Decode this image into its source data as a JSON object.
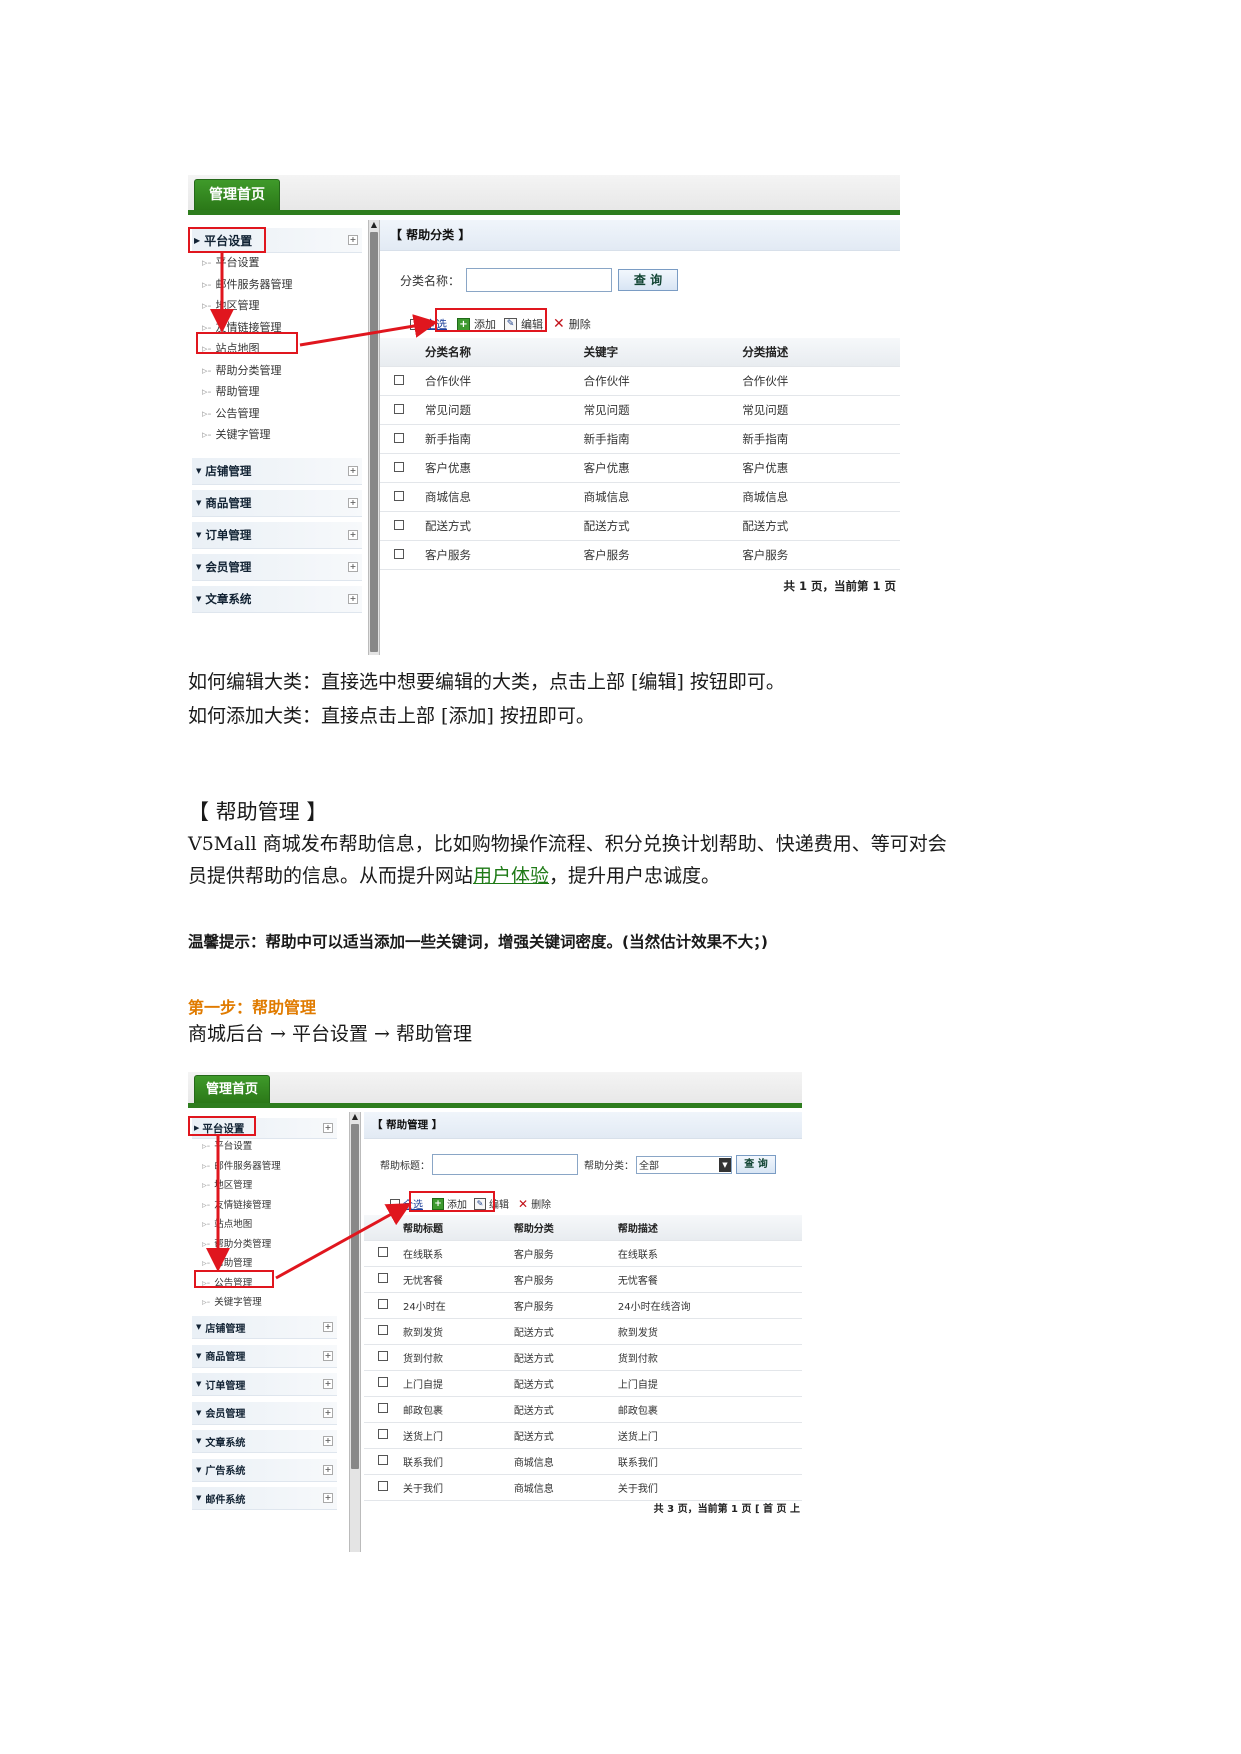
{
  "shot1": {
    "home_tab": "管理首页",
    "platform_menu": "平台设置",
    "sub_items": [
      "平台设置",
      "邮件服务器管理",
      "地区管理",
      "友情链接管理",
      "站点地图",
      "帮助分类管理",
      "帮助管理",
      "公告管理",
      "关键字管理"
    ],
    "other_menus": [
      "店铺管理",
      "商品管理",
      "订单管理",
      "会员管理",
      "文章系统"
    ],
    "section_title": "【  帮助分类  】",
    "search_label": "分类名称：",
    "query_button": "查 询",
    "toolbar": {
      "select_all": "全选",
      "add": "添加",
      "edit": "编辑",
      "delete": "删除"
    },
    "columns": [
      "分类名称",
      "关键字",
      "分类描述"
    ],
    "rows": [
      [
        "合作伙伴",
        "合作伙伴",
        "合作伙伴"
      ],
      [
        "常见问题",
        "常见问题",
        "常见问题"
      ],
      [
        "新手指南",
        "新手指南",
        "新手指南"
      ],
      [
        "客户优惠",
        "客户优惠",
        "客户优惠"
      ],
      [
        "商城信息",
        "商城信息",
        "商城信息"
      ],
      [
        "配送方式",
        "配送方式",
        "配送方式"
      ],
      [
        "客户服务",
        "客户服务",
        "客户服务"
      ]
    ],
    "pager": "共 1 页，当前第 1 页"
  },
  "doc": {
    "edit_line": "如何编辑大类：直接选中想要编辑的大类，点击上部 [编辑] 按钮即可。",
    "add_line": "如何添加大类：直接点击上部 [添加] 按扭即可。",
    "section_heading": "【 帮助管理 】",
    "intro_line1": "V5Mall 商城发布帮助信息，比如购物操作流程、积分兑换计划帮助、快递费用、等可对会",
    "intro_line2_pre": "员提供帮助的信息。从而提升网站",
    "intro_link": "用户体验",
    "intro_line2_post": "，提升用户忠诚度。",
    "tip": "温馨提示：帮助中可以适当添加一些关键词，增强关键词密度。(当然估计效果不大；)",
    "step_title": "第一步：帮助管理",
    "path": "商城后台 → 平台设置 → 帮助管理"
  },
  "shot2": {
    "home_tab": "管理首页",
    "platform_menu": "平台设置",
    "sub_items": [
      "平台设置",
      "邮件服务器管理",
      "地区管理",
      "友情链接管理",
      "站点地图",
      "帮助分类管理",
      "帮助管理",
      "公告管理",
      "关键字管理"
    ],
    "other_menus": [
      "店铺管理",
      "商品管理",
      "订单管理",
      "会员管理",
      "文章系统",
      "广告系统",
      "邮件系统"
    ],
    "section_title": "【  帮助管理  】",
    "title_label": "帮助标题：",
    "category_label": "帮助分类：",
    "category_value": "全部",
    "query_button": "查 询",
    "toolbar": {
      "select_all": "全选",
      "add": "添加",
      "edit": "编辑",
      "delete": "删除"
    },
    "columns": [
      "帮助标题",
      "帮助分类",
      "帮助描述"
    ],
    "rows": [
      [
        "在线联系",
        "客户服务",
        "在线联系"
      ],
      [
        "无忧客餐",
        "客户服务",
        "无忧客餐"
      ],
      [
        "24小时在",
        "客户服务",
        "24小时在线咨询"
      ],
      [
        "款到发货",
        "配送方式",
        "款到发货"
      ],
      [
        "货到付款",
        "配送方式",
        "货到付款"
      ],
      [
        "上门自提",
        "配送方式",
        "上门自提"
      ],
      [
        "邮政包裹",
        "配送方式",
        "邮政包裹"
      ],
      [
        "送货上门",
        "配送方式",
        "送货上门"
      ],
      [
        "联系我们",
        "商城信息",
        "联系我们"
      ],
      [
        "关于我们",
        "商城信息",
        "关于我们"
      ]
    ],
    "pager": "共 3 页，当前第 1 页 [ 首  页  上"
  }
}
